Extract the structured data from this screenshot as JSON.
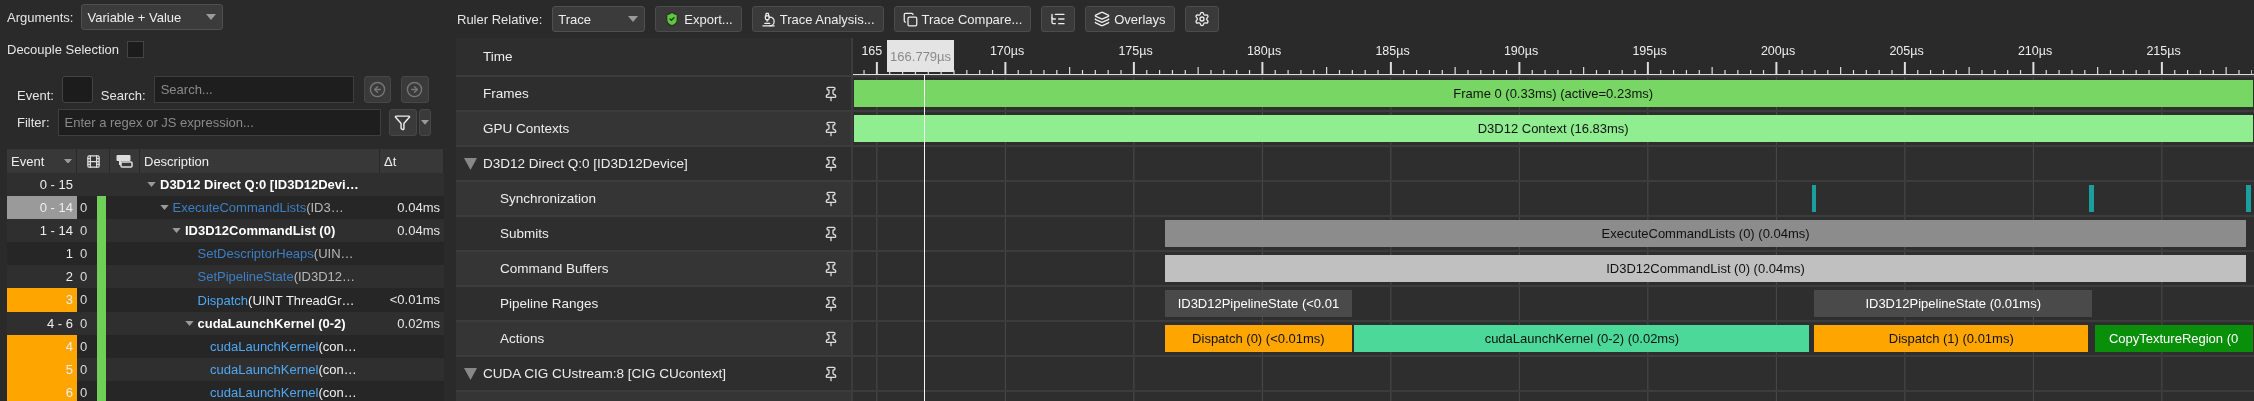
{
  "arguments": {
    "label": "Arguments:",
    "value": "Variable + Value"
  },
  "decouple": {
    "label": "Decouple Selection",
    "checked": false
  },
  "event_field": {
    "label": "Event:"
  },
  "search": {
    "label": "Search:",
    "placeholder": "Search..."
  },
  "filter": {
    "label": "Filter:",
    "placeholder": "Enter a regex or JS expression..."
  },
  "table": {
    "columns": [
      {
        "kind": "text",
        "label": "Event"
      },
      {
        "kind": "frames"
      },
      {
        "kind": "gpu"
      },
      {
        "kind": "text",
        "label": "Description"
      },
      {
        "kind": "text",
        "label": "Δt"
      }
    ],
    "rows": [
      {
        "event": "0 - 15",
        "kind": "group",
        "name": "D3D12 Direct Q:0 [ID3D12Devi…",
        "in_frame": false,
        "expanded": true,
        "children": [
          {
            "event": "0 - 14",
            "frame": "0",
            "kind": "call",
            "name": "ExecuteCommandLists",
            "args": "(ID3…",
            "dt": "0.04ms",
            "color": "#9a9a9a",
            "dimmed": true,
            "in_frame": true,
            "expanded": true,
            "children": [
              {
                "event": "1 - 14",
                "frame": "0",
                "kind": "group",
                "name": "ID3D12CommandList (0)",
                "dt": "0.04ms",
                "in_frame": true,
                "expanded": true,
                "children": [
                  {
                    "event": "1",
                    "frame": "0",
                    "kind": "call",
                    "name": "SetDescriptorHeaps",
                    "args": "(UIN…",
                    "dimmed": true,
                    "in_frame": true
                  },
                  {
                    "event": "2",
                    "frame": "0",
                    "kind": "call",
                    "name": "SetPipelineState",
                    "args": "(ID3D12…",
                    "dimmed": true,
                    "in_frame": true
                  },
                  {
                    "event": "3",
                    "frame": "0",
                    "kind": "call",
                    "name": "Dispatch",
                    "args": "(UINT ThreadGr…",
                    "dt": "<0.01ms",
                    "color": "#ffa500",
                    "dimmed": false,
                    "in_frame": true
                  },
                  {
                    "event": "4 - 6",
                    "frame": "0",
                    "kind": "group",
                    "name": "cudaLaunchKernel (0-2)",
                    "dt": "0.02ms",
                    "in_frame": true,
                    "expanded": true,
                    "children": [
                      {
                        "event": "4",
                        "frame": "0",
                        "kind": "call",
                        "name": "cudaLaunchKernel",
                        "args": "(con…",
                        "color": "#ffa500",
                        "dimmed": false,
                        "in_frame": true
                      },
                      {
                        "event": "5",
                        "frame": "0",
                        "kind": "call",
                        "name": "cudaLaunchKernel",
                        "args": "(con…",
                        "color": "#ffa500",
                        "dimmed": false,
                        "in_frame": true
                      },
                      {
                        "event": "6",
                        "frame": "0",
                        "kind": "call",
                        "name": "cudaLaunchKernel",
                        "args": "(con…",
                        "color": "#ffa500",
                        "dimmed": false,
                        "in_frame": true
                      }
                    ]
                  }
                ]
              }
            ]
          }
        ]
      }
    ]
  },
  "toolbar": {
    "ruler_label": "Ruler Relative:",
    "ruler_value": "Trace",
    "buttons": [
      {
        "kind": "export",
        "label": "Export..."
      },
      {
        "kind": "analysis",
        "label": "Trace Analysis..."
      },
      {
        "kind": "compare",
        "label": "Trace Compare..."
      },
      {
        "kind": "tree"
      },
      {
        "kind": "overlays",
        "label": "Overlays"
      },
      {
        "kind": "settings"
      }
    ]
  },
  "timeline": {
    "header": "Time",
    "ticks": [
      "165",
      "170µs",
      "175µs",
      "180µs",
      "185µs",
      "190µs",
      "195µs",
      "200µs",
      "205µs",
      "210µs",
      "215µs"
    ],
    "cursor": "166.779µs",
    "tracks": [
      {
        "kind": "track",
        "label": "Frames",
        "bars": [
          {
            "label": "Frame 0 (0.33ms) (active=0.23ms)",
            "color": "#78d764"
          }
        ]
      },
      {
        "kind": "track",
        "label": "GPU Contexts",
        "bars": [
          {
            "label": "D3D12 Context (16.83ms)",
            "color": "#90ee90"
          }
        ]
      },
      {
        "kind": "group",
        "label": "D3D12 Direct Q:0 [ID3D12Device]",
        "expanded": true,
        "children": [
          {
            "kind": "track",
            "label": "Synchronization",
            "bars": [
              {
                "color": "#1a9e9e"
              },
              {
                "color": "#1a9e9e"
              },
              {
                "color": "#1a9e9e"
              }
            ]
          },
          {
            "kind": "track",
            "label": "Submits",
            "bars": [
              {
                "label": "ExecuteCommandLists (0) (0.04ms)",
                "color": "#8c8c8c"
              }
            ]
          },
          {
            "kind": "track",
            "label": "Command Buffers",
            "bars": [
              {
                "label": "ID3D12CommandList (0) (0.04ms)",
                "color": "#c0c0c0"
              }
            ]
          },
          {
            "kind": "track",
            "label": "Pipeline Ranges",
            "bars": [
              {
                "label": "ID3D12PipelineState (<0.01",
                "color": "#4a4a4a"
              },
              {
                "label": "ID3D12PipelineState (0.01ms)",
                "color": "#4a4a4a"
              }
            ]
          },
          {
            "kind": "track",
            "label": "Actions",
            "bars": [
              {
                "label": "Dispatch (0) (<0.01ms)",
                "color": "#ffa500"
              },
              {
                "label": "cudaLaunchKernel (0-2) (0.02ms)",
                "color": "#4cd898"
              },
              {
                "label": "Dispatch (1) (0.01ms)",
                "color": "#ffa500"
              },
              {
                "label": "CopyTextureRegion (0",
                "color": "#0a8f0a"
              }
            ]
          }
        ]
      },
      {
        "kind": "group",
        "label": "CUDA CIG CUstream:8 [CIG CUcontext]",
        "expanded": true
      }
    ]
  }
}
